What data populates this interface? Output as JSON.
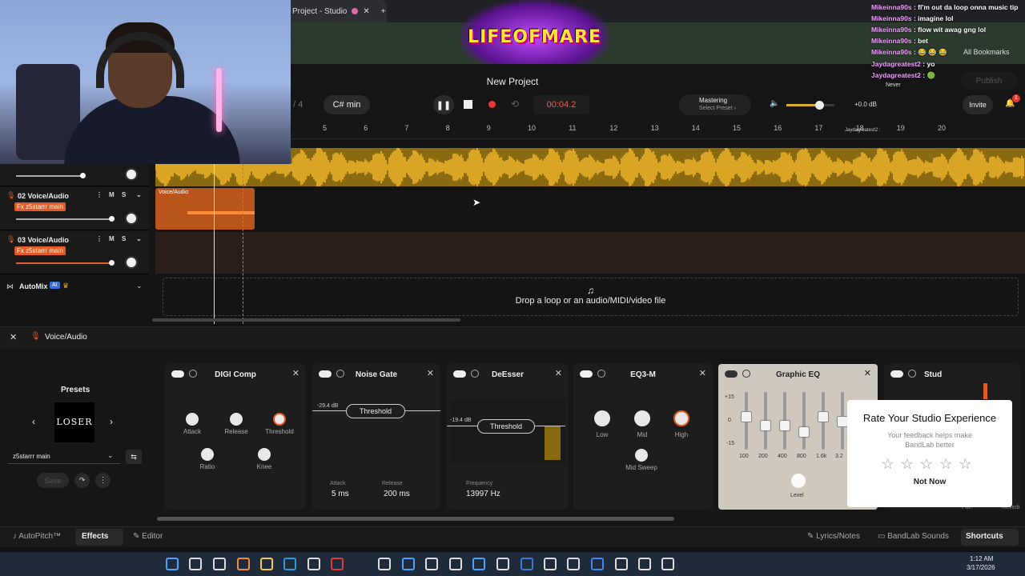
{
  "browser": {
    "tab_title": "Project - Studio",
    "bookmarks_label": "All Bookmarks"
  },
  "overlay": {
    "brand_text": "LIFEOFMARE"
  },
  "project": {
    "name": "New Project",
    "key": "C# min",
    "time_sig": "/ 4",
    "timer": "00:04.2"
  },
  "mastering": {
    "label": "Mastering",
    "preset": "Select Preset ›"
  },
  "volume": {
    "db": "+0.0 dB"
  },
  "actions": {
    "invite": "Invite",
    "publish": "Publish",
    "notif_count": "1"
  },
  "ruler": {
    "bars": [
      "5",
      "6",
      "7",
      "8",
      "9",
      "10",
      "11",
      "12",
      "13",
      "14",
      "15",
      "16",
      "17",
      "18",
      "19",
      "20"
    ],
    "marker": "Jaydagreatest2 :"
  },
  "tracks": [
    {
      "num": "02",
      "name": "Voice/Audio",
      "fx": "Fx z5starrr main",
      "clip": "Voice/Audio"
    },
    {
      "num": "03",
      "name": "Voice/Audio",
      "fx": "Fx z5starrr main"
    }
  ],
  "automix": {
    "label": "AutoMix",
    "badge": "AI"
  },
  "drop_text": "Drop a loop or an audio/MIDI/video file",
  "fx_header": {
    "title": "Voice/Audio"
  },
  "presets": {
    "title": "Presets",
    "preset_name": "z5starrr main",
    "save": "Save",
    "art_text": "LOSER"
  },
  "effects": {
    "digi": {
      "title": "DIGI Comp",
      "attack": "Attack",
      "release": "Release",
      "threshold": "Threshold",
      "ratio": "Ratio",
      "knee": "Knee"
    },
    "gate": {
      "title": "Noise Gate",
      "db": "-29.4 dB",
      "threshold": "Threshold",
      "attack_label": "Attack",
      "attack": "5 ms",
      "release_label": "Release",
      "release": "200 ms"
    },
    "desser": {
      "title": "DeEsser",
      "db": "-19.4 dB",
      "threshold": "Threshold",
      "freq_label": "Frequency",
      "freq": "13997 Hz"
    },
    "eq3": {
      "title": "EQ3-M",
      "low": "Low",
      "mid": "Mid",
      "high": "High",
      "sweep": "Mid Sweep"
    },
    "geq": {
      "title": "Graphic EQ",
      "scale": [
        "+15",
        "0",
        "-15"
      ],
      "bands": [
        "100",
        "200",
        "400",
        "800",
        "1.6k",
        "3.2"
      ],
      "level": "Level"
    },
    "stud": {
      "title": "Stud",
      "pan": "Pan",
      "reverb": "Reverb"
    }
  },
  "popup": {
    "title": "Rate Your Studio Experience",
    "subtitle": "Your feedback helps make BandLab better",
    "not_now": "Not Now"
  },
  "bottom": {
    "autopitch": "AutoPitch™",
    "effects": "Effects",
    "editor": "Editor",
    "lyrics": "Lyrics/Notes",
    "sounds": "BandLab Sounds",
    "shortcuts": "Shortcuts"
  },
  "taskbar": {
    "time": "1:12 AM",
    "date": "3/17/2026"
  },
  "chat": [
    {
      "user": "Mikeinna90s",
      "msg": ": fl'm out da loop onna music tip"
    },
    {
      "user": "Mikeinna90s",
      "msg": ": imagine lol"
    },
    {
      "user": "Mikeinna90s",
      "msg": ": flow wit awag gng lol"
    },
    {
      "user": "Mikeinna90s",
      "msg": ": bet"
    },
    {
      "user": "Mikeinna90s",
      "msg": ": 😂 😂 😂"
    },
    {
      "user": "Jaydagreatest2",
      "msg": ": yo"
    },
    {
      "user": "Jaydagreatest2",
      "msg": ": 🟢"
    }
  ],
  "chat_extra": {
    "never": "Never"
  }
}
